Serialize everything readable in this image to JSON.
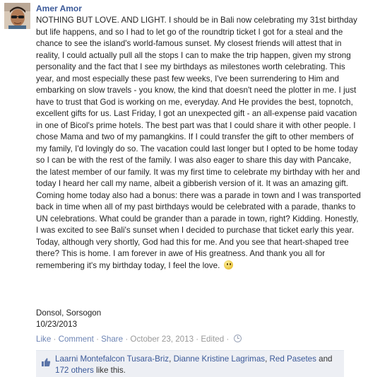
{
  "post": {
    "author": "Amer Amor",
    "body": "NOTHING BUT LOVE. AND LIGHT. I should be in Bali now celebrating my 31st birthday but life happens, and so I had to let go of the roundtrip ticket I got for a steal and the chance to see the island's world-famous sunset. My closest friends will attest that in reality, I could actually pull all the stops I can to make the trip happen, given my strong personality and the fact that I see my birthdays as milestones worth celebrating. This year, and most especially these past few weeks, I've been surrendering to Him and embarking on slow travels - you know, the kind that doesn't need the plotter in me. I just have to trust that God is working on me, everyday. And He provides the best, topnotch, excellent gifts for us. Last Friday, I got an unexpected gift - an all-expense paid vacation in one of Bicol's prime hotels. The best part was that I could share it with other people. I chose Mama and two of my pamangkins. If I could transfer the gift to other members of my family, I'd lovingly do so. The vacation could last longer but I opted to be home today so I can be with the rest of the family. I was also eager to share this day with Pancake, the latest member of our family. It was my first time to celebrate my birthday with her and today I heard her call my name, albeit a gibberish version of it. It was an amazing gift. Coming home today also had a bonus: there was a parade in town and I was transported back in time when all of my past birthdays would be celebrated with a parade, thanks to UN celebrations. What could be grander than a parade in town, right? Kidding. Honestly, I was excited to see Bali's sunset when I decided to purchase that ticket early this year. Today, although very shortly, God had this for me. And you see that heart-shaped tree there? This is home. I am forever in awe of His greatness. And thank you all for remembering it's my birthday today, I feel the love. ",
    "emoticon": "smiley-icon",
    "location": "Donsol, Sorsogon",
    "date": "10/23/2013"
  },
  "actions": {
    "like": "Like",
    "comment": "Comment",
    "share": "Share",
    "separator": " · ",
    "timestamp": "October 23, 2013",
    "edited": "Edited",
    "privacy_icon": "clock-icon"
  },
  "likes": {
    "icon": "thumbs-up-icon",
    "names": [
      "Laarni Montefalcon Tusara-Briz",
      "Dianne Kristine Lagrimas",
      "Red Pasetes"
    ],
    "connector1": ", ",
    "connector2": ", ",
    "and_text": " and ",
    "others": "172 others",
    "suffix": " like this."
  },
  "colors": {
    "link": "#3b5998",
    "action_link": "#6d84b4",
    "likes_bg": "#edeff4",
    "meta_gray": "#999999"
  }
}
